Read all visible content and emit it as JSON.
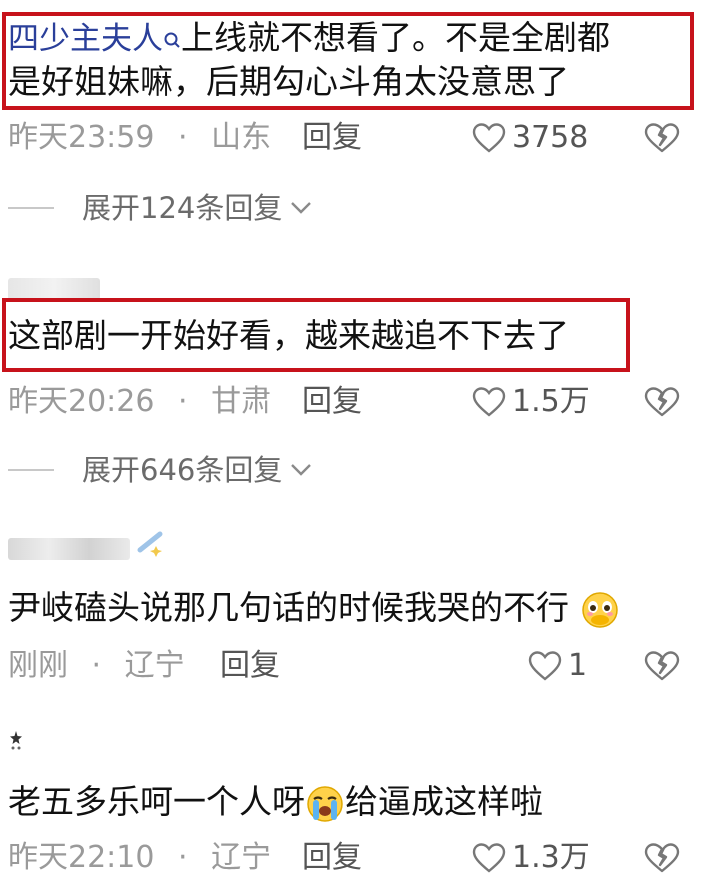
{
  "comments": [
    {
      "username": "四少主夫人",
      "text": "上线就不想看了。不是全剧都是好姐妹嘛，后期勾心斗角太没意思了",
      "text_line1": "上线就不想看了。不是全剧都",
      "text_line2": "是好姐妹嘛，后期勾心斗角太没意思了",
      "time": "昨天23:59",
      "location": "山东",
      "reply_label": "回复",
      "likes": "3758",
      "expand_label": "展开124条回复"
    },
    {
      "text": "这部剧一开始好看，越来越追不下去了",
      "time": "昨天20:26",
      "location": "甘肃",
      "reply_label": "回复",
      "likes": "1.5万",
      "expand_label": "展开646条回复"
    },
    {
      "text": "尹岐磕头说那几句话的时候我哭的不行",
      "time": "刚刚",
      "location": "辽宁",
      "reply_label": "回复",
      "likes": "1"
    },
    {
      "text_before_emoji": "老五多乐呵一个人呀",
      "text_after_emoji": "给逼成这样啦",
      "time": "昨天22:10",
      "location": "辽宁",
      "reply_label": "回复",
      "likes": "1.3万"
    }
  ],
  "separator": "·",
  "icons": {
    "like": "heart-outline-icon",
    "dislike": "broken-heart-icon",
    "expand": "chevron-down-icon",
    "search": "search-icon"
  },
  "colors": {
    "highlight": "#c7121b",
    "username": "#2a3f9a",
    "meta": "#9a9a9a"
  }
}
